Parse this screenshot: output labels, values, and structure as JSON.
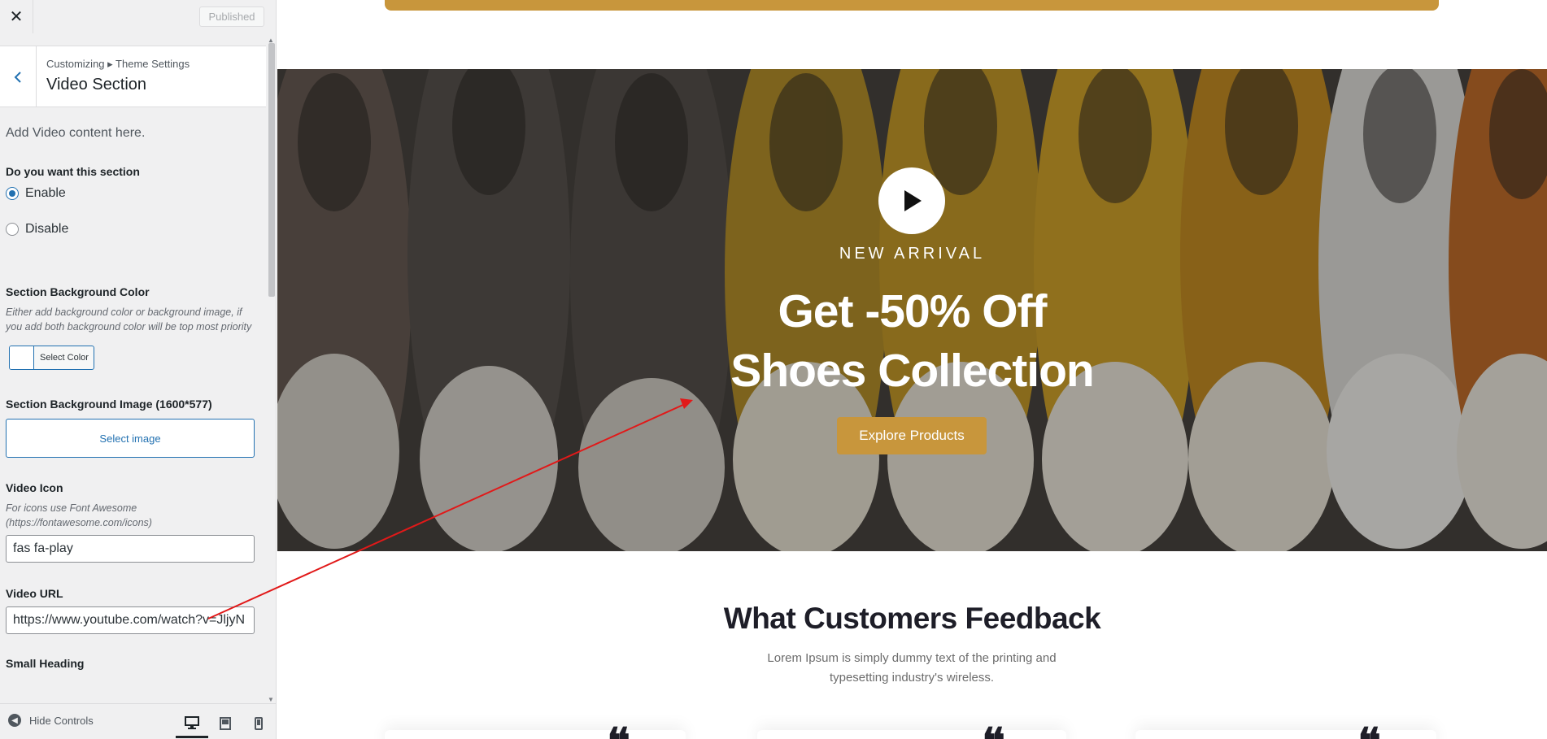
{
  "topbar": {
    "close_label": "✕",
    "published_label": "Published"
  },
  "section_head": {
    "breadcrumb": "Customizing ▸ Theme Settings",
    "title": "Video Section"
  },
  "panel": {
    "description": "Add Video content here.",
    "enable_section": {
      "label": "Do you want this section",
      "options": [
        "Enable",
        "Disable"
      ],
      "selected": "Enable"
    },
    "bg_color": {
      "label": "Section Background Color",
      "hint": "Either add background color or background image, if you add both background color will be top most priority",
      "button_label": "Select Color"
    },
    "bg_image": {
      "label": "Section Background Image (1600*577)",
      "button_label": "Select image"
    },
    "video_icon": {
      "label": "Video Icon",
      "hint": "For icons use Font Awesome (https://fontawesome.com/icons)",
      "value": "fas fa-play"
    },
    "video_url": {
      "label": "Video URL",
      "value": "https://www.youtube.com/watch?v=JljyN"
    },
    "small_heading": {
      "label": "Small Heading"
    }
  },
  "footer": {
    "hide_controls_label": "Hide Controls",
    "devices": [
      "desktop-icon",
      "tablet-icon",
      "mobile-icon"
    ]
  },
  "preview": {
    "hero": {
      "small_heading": "NEW ARRIVAL",
      "heading_line1": "Get -50% Off",
      "heading_line2": "Shoes Collection",
      "button_label": "Explore Products"
    },
    "feedback": {
      "title": "What Customers Feedback",
      "text": "Lorem Ipsum is simply dummy text of the printing and typesetting industry's wireless."
    }
  },
  "colors": {
    "accent": "#c8963c",
    "wp_blue": "#2271b1",
    "arrow": "#e11919"
  }
}
